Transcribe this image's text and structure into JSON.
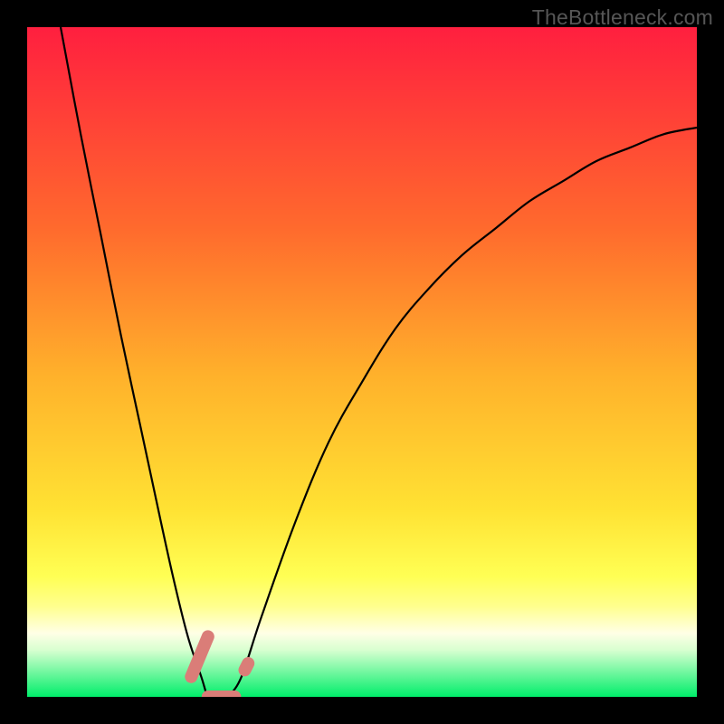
{
  "watermark": "TheBottleneck.com",
  "colors": {
    "top": "#ff1f3f",
    "mid1": "#ff6a2d",
    "mid2": "#ffb12b",
    "mid3": "#ffe233",
    "band": "#ffff8e",
    "bottom": "#00ee6a",
    "marker": "#da7d78",
    "curve": "#000000"
  },
  "chart_data": {
    "type": "line",
    "title": "",
    "xlabel": "",
    "ylabel": "",
    "xlim": [
      0,
      100
    ],
    "ylim": [
      0,
      100
    ],
    "note": "V-shaped bottleneck curve; both branches approach 0 at the minimum near x≈27. Values estimated from pixel positions.",
    "series": [
      {
        "name": "left-branch",
        "x": [
          5,
          8,
          11,
          14,
          17,
          20,
          22,
          24,
          26,
          27,
          28,
          30
        ],
        "y": [
          100,
          84,
          69,
          54,
          40,
          26,
          17,
          9,
          3,
          0,
          0,
          0
        ]
      },
      {
        "name": "right-branch",
        "x": [
          30,
          32,
          35,
          40,
          45,
          50,
          55,
          60,
          65,
          70,
          75,
          80,
          85,
          90,
          95,
          100
        ],
        "y": [
          0,
          3,
          12,
          26,
          38,
          47,
          55,
          61,
          66,
          70,
          74,
          77,
          80,
          82,
          84,
          85
        ]
      }
    ],
    "markers": [
      {
        "name": "marker-left",
        "x_range": [
          24.5,
          27
        ],
        "y_range": [
          3,
          9
        ]
      },
      {
        "name": "marker-bottom",
        "x_range": [
          27,
          31
        ],
        "y_range": [
          0,
          0
        ]
      },
      {
        "name": "marker-right-dot",
        "x_range": [
          32.5,
          33
        ],
        "y_range": [
          4,
          5
        ]
      }
    ]
  }
}
